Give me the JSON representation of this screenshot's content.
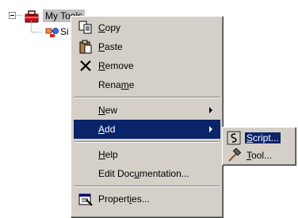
{
  "tree": {
    "root_label": "My Tools",
    "child_label": "Si"
  },
  "menu": {
    "items": [
      {
        "key": "copy",
        "pre": "",
        "u": "C",
        "post": "opy",
        "icon": "copy-icon",
        "submenu": false
      },
      {
        "key": "paste",
        "pre": "",
        "u": "P",
        "post": "aste",
        "icon": "paste-icon",
        "submenu": false
      },
      {
        "key": "remove",
        "pre": "",
        "u": "R",
        "post": "emove",
        "icon": "remove-icon",
        "submenu": false
      },
      {
        "key": "rename",
        "pre": "Rena",
        "u": "m",
        "post": "e",
        "icon": "",
        "submenu": false
      },
      {
        "key": "new",
        "pre": "",
        "u": "N",
        "post": "ew",
        "icon": "",
        "submenu": true
      },
      {
        "key": "add",
        "pre": "",
        "u": "A",
        "post": "dd",
        "icon": "",
        "submenu": true,
        "highlighted": true
      },
      {
        "key": "help",
        "pre": "",
        "u": "H",
        "post": "elp",
        "icon": "",
        "submenu": false
      },
      {
        "key": "edit_documentation",
        "pre": "Edit Doc",
        "u": "u",
        "post": "mentation...",
        "icon": "",
        "submenu": false
      },
      {
        "key": "properties",
        "pre": "Propert",
        "u": "i",
        "post": "es...",
        "icon": "properties-icon",
        "submenu": false
      }
    ]
  },
  "submenu": {
    "items": [
      {
        "key": "script",
        "pre": "",
        "u": "S",
        "post": "cript...",
        "icon": "script-icon",
        "highlighted": true
      },
      {
        "key": "tool",
        "pre": "",
        "u": "T",
        "post": "ool...",
        "icon": "hammer-icon"
      }
    ]
  },
  "colors": {
    "menu_bg": "#d4d0c8",
    "highlight": "#0a246a",
    "highlight_text": "#ffffff",
    "selected_node": "#c0c0c0"
  }
}
